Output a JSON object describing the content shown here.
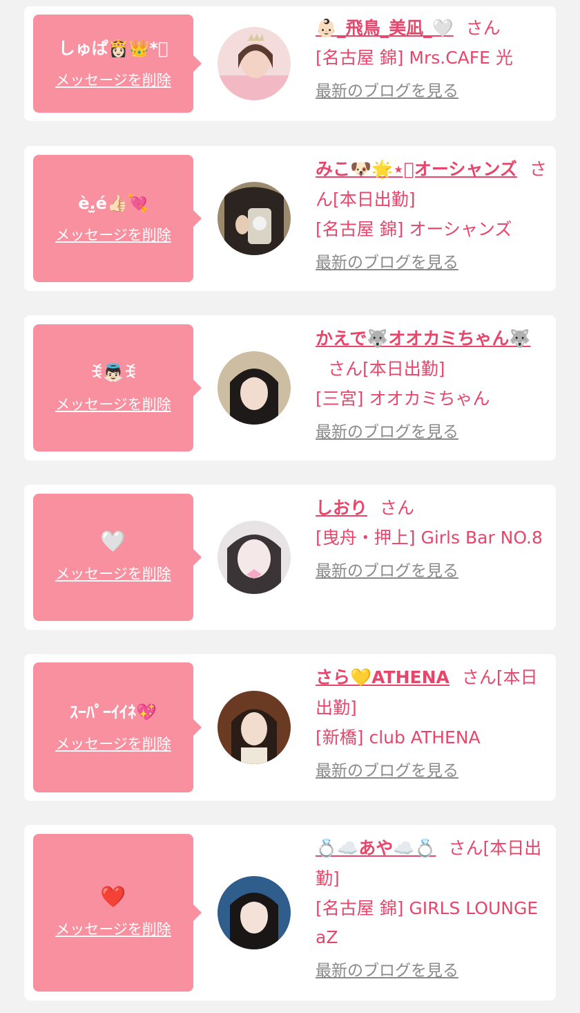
{
  "delete_label": "メッセージを削除",
  "san_label": "さん",
  "blog_label": "最新のブログを見る",
  "colors": {
    "background": "#f2f2f2",
    "card": "#ffffff",
    "bubble": "#f8909f",
    "accent_pink": "#e8456b",
    "link_gray": "#8a8a8a"
  },
  "entries": [
    {
      "message": "しゅぱ👸🏻👑*゚",
      "name": "👶🏻_飛鳥_美凪_🤍",
      "tag": "",
      "shop": "[名古屋 錦] Mrs.CAFE 光"
    },
    {
      "message": "è.̫é👍🏻💘",
      "name": "みこ🐶🌟⋆゚オーシャンズ",
      "tag": "[本日出勤]",
      "shop": "[名古屋 錦] オーシャンズ"
    },
    {
      "message": "ꉂ👼🏻ꉂ",
      "name": "かえで🐺オオカミちゃん🐺",
      "tag": "[本日出勤]",
      "shop": "[三宮] オオカミちゃん"
    },
    {
      "message": "🤍",
      "name": "しおり",
      "tag": "",
      "shop": "[曳舟・押上] Girls Bar NO.8"
    },
    {
      "message": "ｽｰﾊﾟｰｲｲﾈ💖",
      "name": "さら💛ATHENA",
      "tag": "[本日出勤]",
      "shop": "[新橋] club ATHENA"
    },
    {
      "message": "❤️",
      "name": "💍☁️あや☁️💍",
      "tag": "[本日出勤]",
      "shop": "[名古屋 錦] GIRLS LOUNGE aZ"
    }
  ]
}
